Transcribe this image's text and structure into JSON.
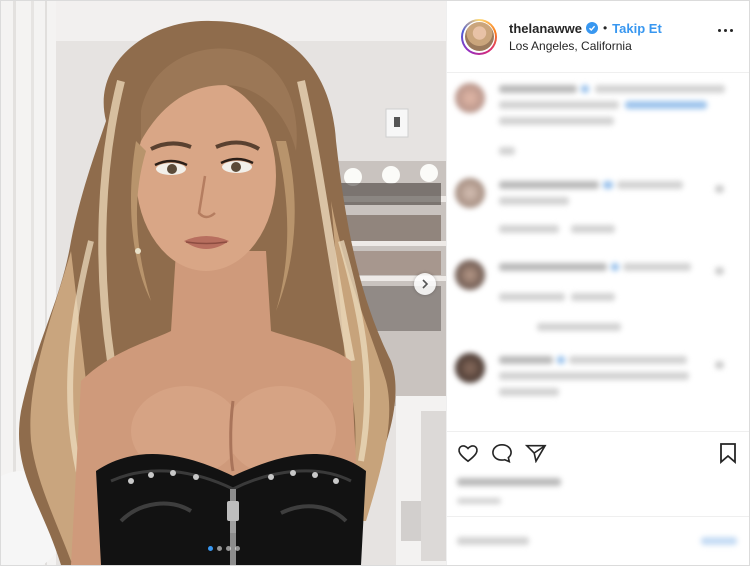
{
  "header": {
    "username": "thelanawwe",
    "separator": "•",
    "follow_label": "Takip Et",
    "location": "Los Angeles, California"
  },
  "carousel": {
    "slide_count": 4,
    "active_index": 0
  },
  "icons": {
    "verified": "verified-badge-icon",
    "more": "more-options-icon",
    "next": "chevron-right-icon",
    "like": "heart-icon",
    "comment": "comment-icon",
    "share": "share-icon",
    "save": "bookmark-icon"
  },
  "colors": {
    "accent": "#3897f0",
    "border": "#dbdbdb",
    "text": "#262626"
  }
}
